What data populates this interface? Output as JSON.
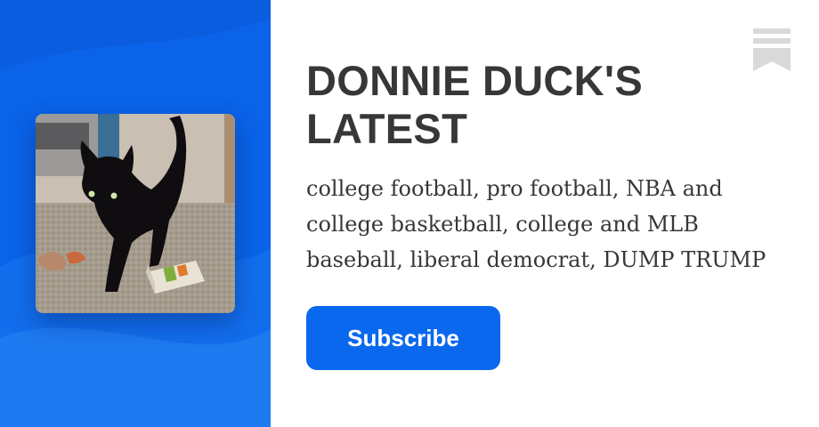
{
  "publication": {
    "title": "DONNIE DUCK'S LATEST",
    "description": "college football, pro football, NBA and college basketball, college and MLB baseball, liberal democrat, DUMP TRUMP",
    "subscribe_label": "Subscribe"
  },
  "avatar": {
    "subject": "black cat on carpet with toys"
  },
  "icons": {
    "bookmark": "bookmark-icon"
  },
  "colors": {
    "accent": "#0a63e8",
    "button": "#0a68ee",
    "text": "#363737",
    "icon": "#d9d9d9"
  }
}
